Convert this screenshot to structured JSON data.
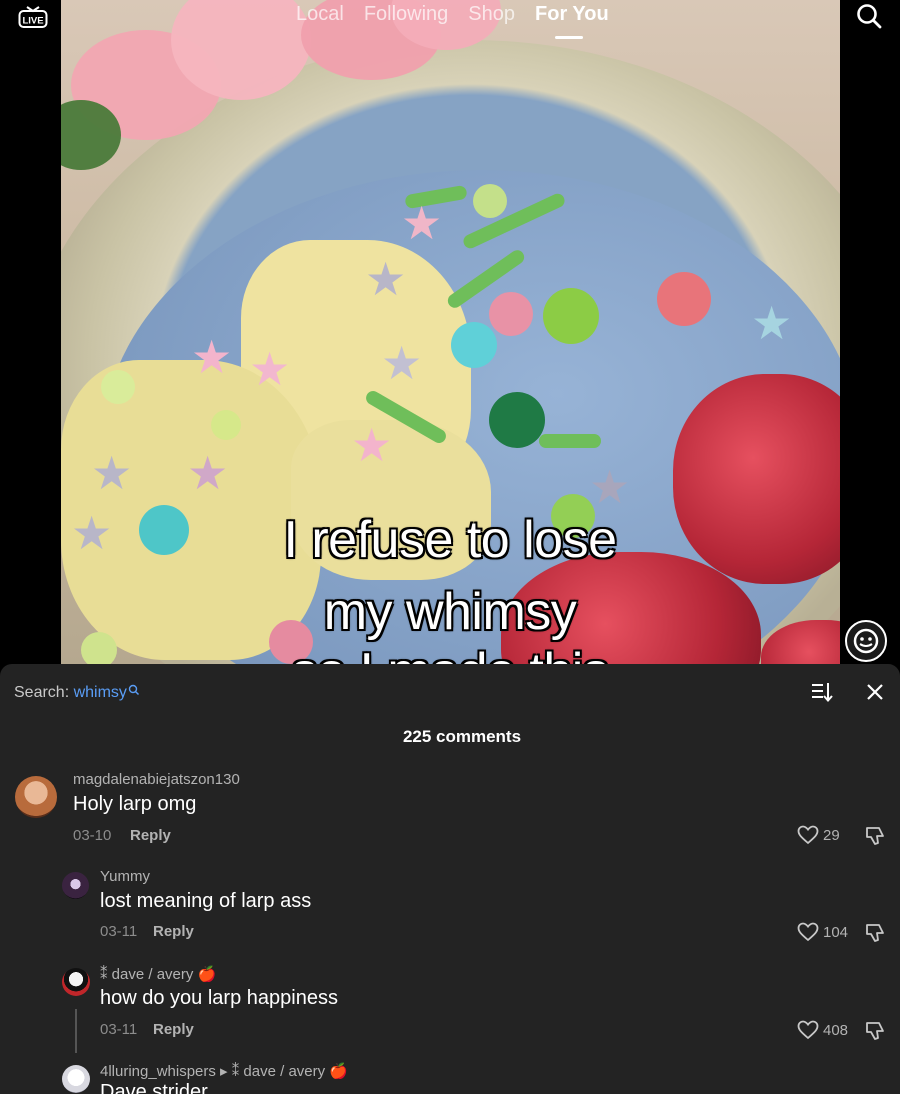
{
  "nav": {
    "live_label": "LIVE",
    "tabs": [
      {
        "label": "Local"
      },
      {
        "label": "Following"
      },
      {
        "label": "Shop"
      },
      {
        "label": "For You"
      }
    ]
  },
  "video": {
    "caption_lines": [
      "I refuse to lose",
      "my whimsy",
      "so I made this"
    ]
  },
  "comments_panel": {
    "search_prefix": "Search:",
    "search_term": "whimsy",
    "count_label": "225 comments",
    "comments": [
      {
        "username": "magdalenabiejatszon130",
        "text": "Holy larp omg",
        "date": "03-10",
        "reply_label": "Reply",
        "likes": "29"
      },
      {
        "username": "Yummy",
        "text": "lost meaning of larp ass",
        "date": "03-11",
        "reply_label": "Reply",
        "likes": "104"
      },
      {
        "username": "⁑ dave / avery 🍎",
        "text": "how do you larp happiness",
        "date": "03-11",
        "reply_label": "Reply",
        "likes": "408"
      },
      {
        "username": "4lluring_whispers ▸ ⁑ dave / avery 🍎",
        "text": "Dave strider",
        "date": "",
        "reply_label": "",
        "likes": ""
      }
    ]
  },
  "colors": {
    "sheet_bg": "#232323",
    "search_term": "#5a9df5",
    "muted_text": "#b3b3b3"
  }
}
